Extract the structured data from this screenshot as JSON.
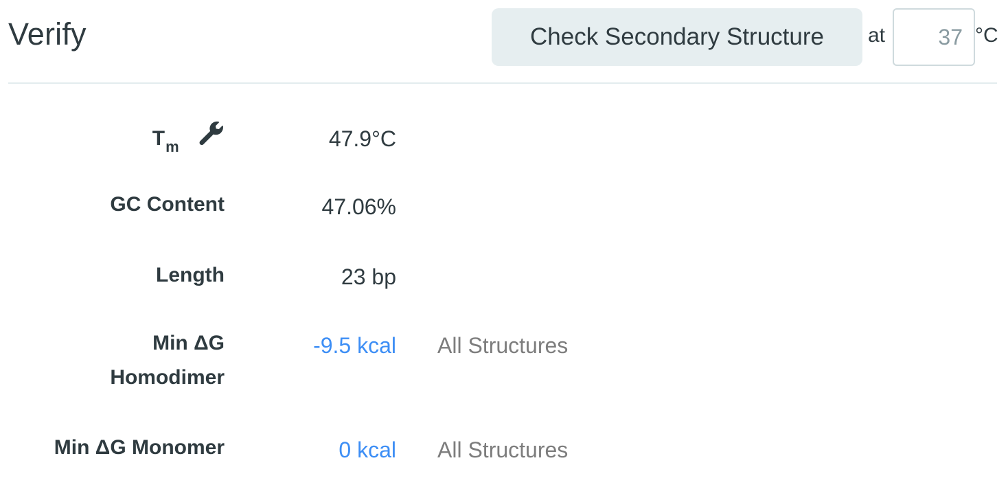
{
  "header": {
    "title": "Verify",
    "check_button_label": "Check Secondary Structure",
    "at_label": "at",
    "temperature_value": "37",
    "temperature_unit": "°C"
  },
  "rows": {
    "tm": {
      "label_main": "T",
      "label_sub": "m",
      "icon": "wrench-icon",
      "value": "47.9°C"
    },
    "gc": {
      "label": "GC Content",
      "value": "47.06%"
    },
    "length": {
      "label": "Length",
      "value": "23 bp"
    },
    "homodimer": {
      "label_line1": "Min ΔG",
      "label_line2": "Homodimer",
      "value": "-9.5 kcal",
      "extra": "All Structures"
    },
    "monomer": {
      "label": "Min ΔG Monomer",
      "value": "0 kcal",
      "extra": "All Structures"
    }
  },
  "colors": {
    "text": "#2f3b40",
    "link": "#3d8ef5",
    "muted": "#7d7d7d",
    "button_bg": "#e6eef0"
  }
}
